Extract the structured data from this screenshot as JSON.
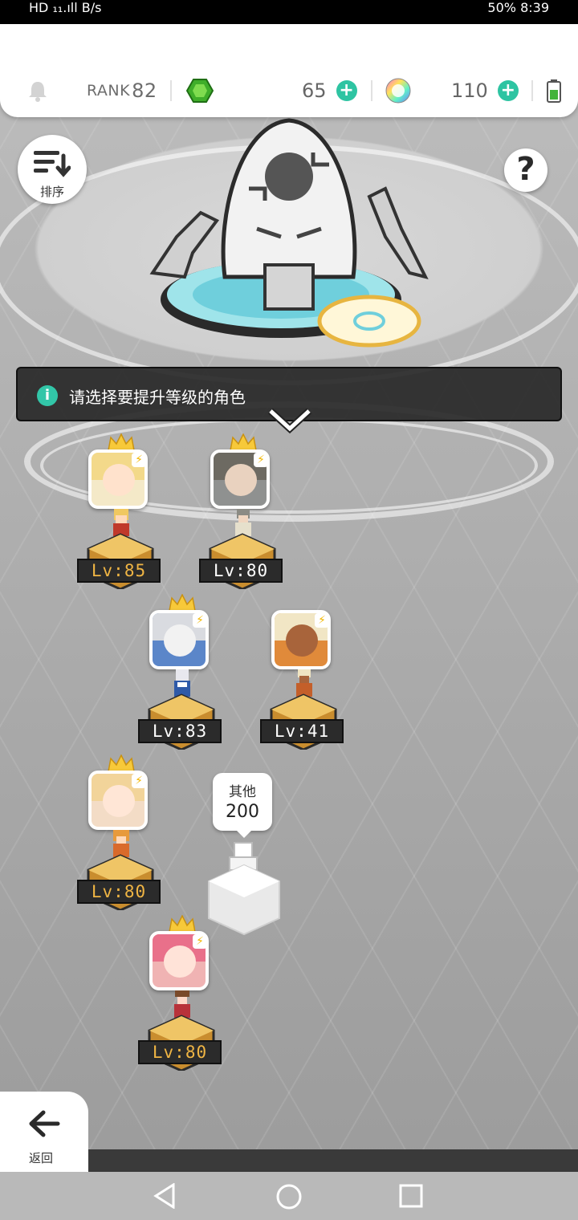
{
  "status_bar": {
    "left_text": "HD ₁₁.ıll B/s",
    "right_text": "50% 8:39"
  },
  "topbar": {
    "rank_label": "RANK",
    "rank_value": "82",
    "gem_count": "65",
    "crystal_count": "110"
  },
  "sort_button": {
    "label": "排序"
  },
  "help_button": {
    "label": "?"
  },
  "notice": {
    "text": "请选择要提升等级的角色"
  },
  "characters": [
    {
      "level": "Lv:85",
      "crowned": true
    },
    {
      "level": "Lv:80",
      "crowned": true
    },
    {
      "level": "Lv:83",
      "crowned": true
    },
    {
      "level": "Lv:41",
      "crowned": false
    },
    {
      "level": "Lv:80",
      "crowned": true
    },
    {
      "level": "Lv:80",
      "crowned": true
    }
  ],
  "others": {
    "label": "其他",
    "count": "200"
  },
  "back_button": {
    "label": "返回"
  },
  "colors": {
    "accent": "#2ec4a2",
    "level_gold": "#f0b544",
    "pedestal": "#e2b04a"
  }
}
